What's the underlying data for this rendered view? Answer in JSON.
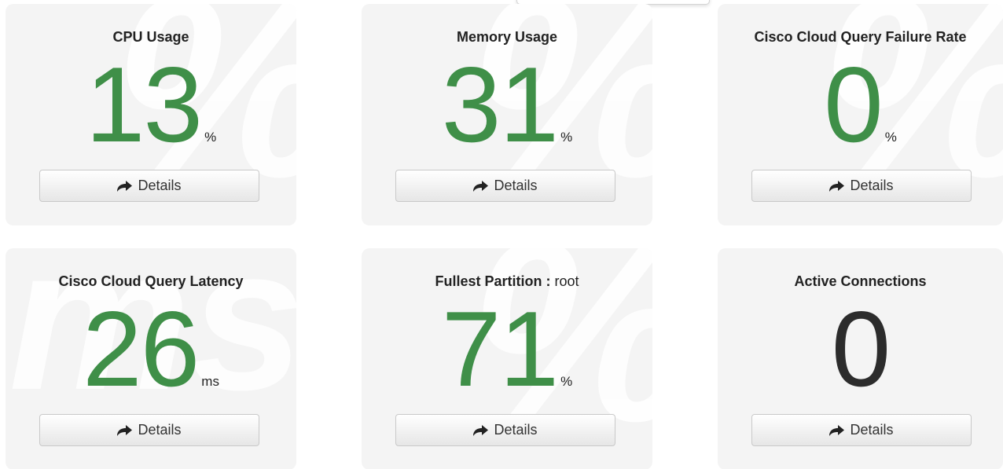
{
  "cards": [
    {
      "title": "CPU Usage",
      "value": "13",
      "unit": "%",
      "watermark": "%",
      "details_label": "Details"
    },
    {
      "title": "Memory Usage",
      "value": "31",
      "unit": "%",
      "watermark": "%",
      "details_label": "Details"
    },
    {
      "title": "Cisco Cloud Query Failure Rate",
      "value": "0",
      "unit": "%",
      "watermark": "%",
      "details_label": "Details"
    },
    {
      "title": "Cisco Cloud Query Latency",
      "value": "26",
      "unit": "ms",
      "watermark": "ms",
      "details_label": "Details"
    },
    {
      "title": "Fullest Partition",
      "title_separator": " : ",
      "title_extra": "root",
      "value": "71",
      "unit": "%",
      "watermark": "%",
      "details_label": "Details"
    },
    {
      "title": "Active Connections",
      "value": "0",
      "details_label": "Details"
    }
  ],
  "colors": {
    "metric_green": "#3f8f48",
    "metric_neutral": "#2c2c2c",
    "card_background": "#f4f4f4"
  },
  "icons": {
    "details_button_icon": "share-arrow-icon"
  }
}
